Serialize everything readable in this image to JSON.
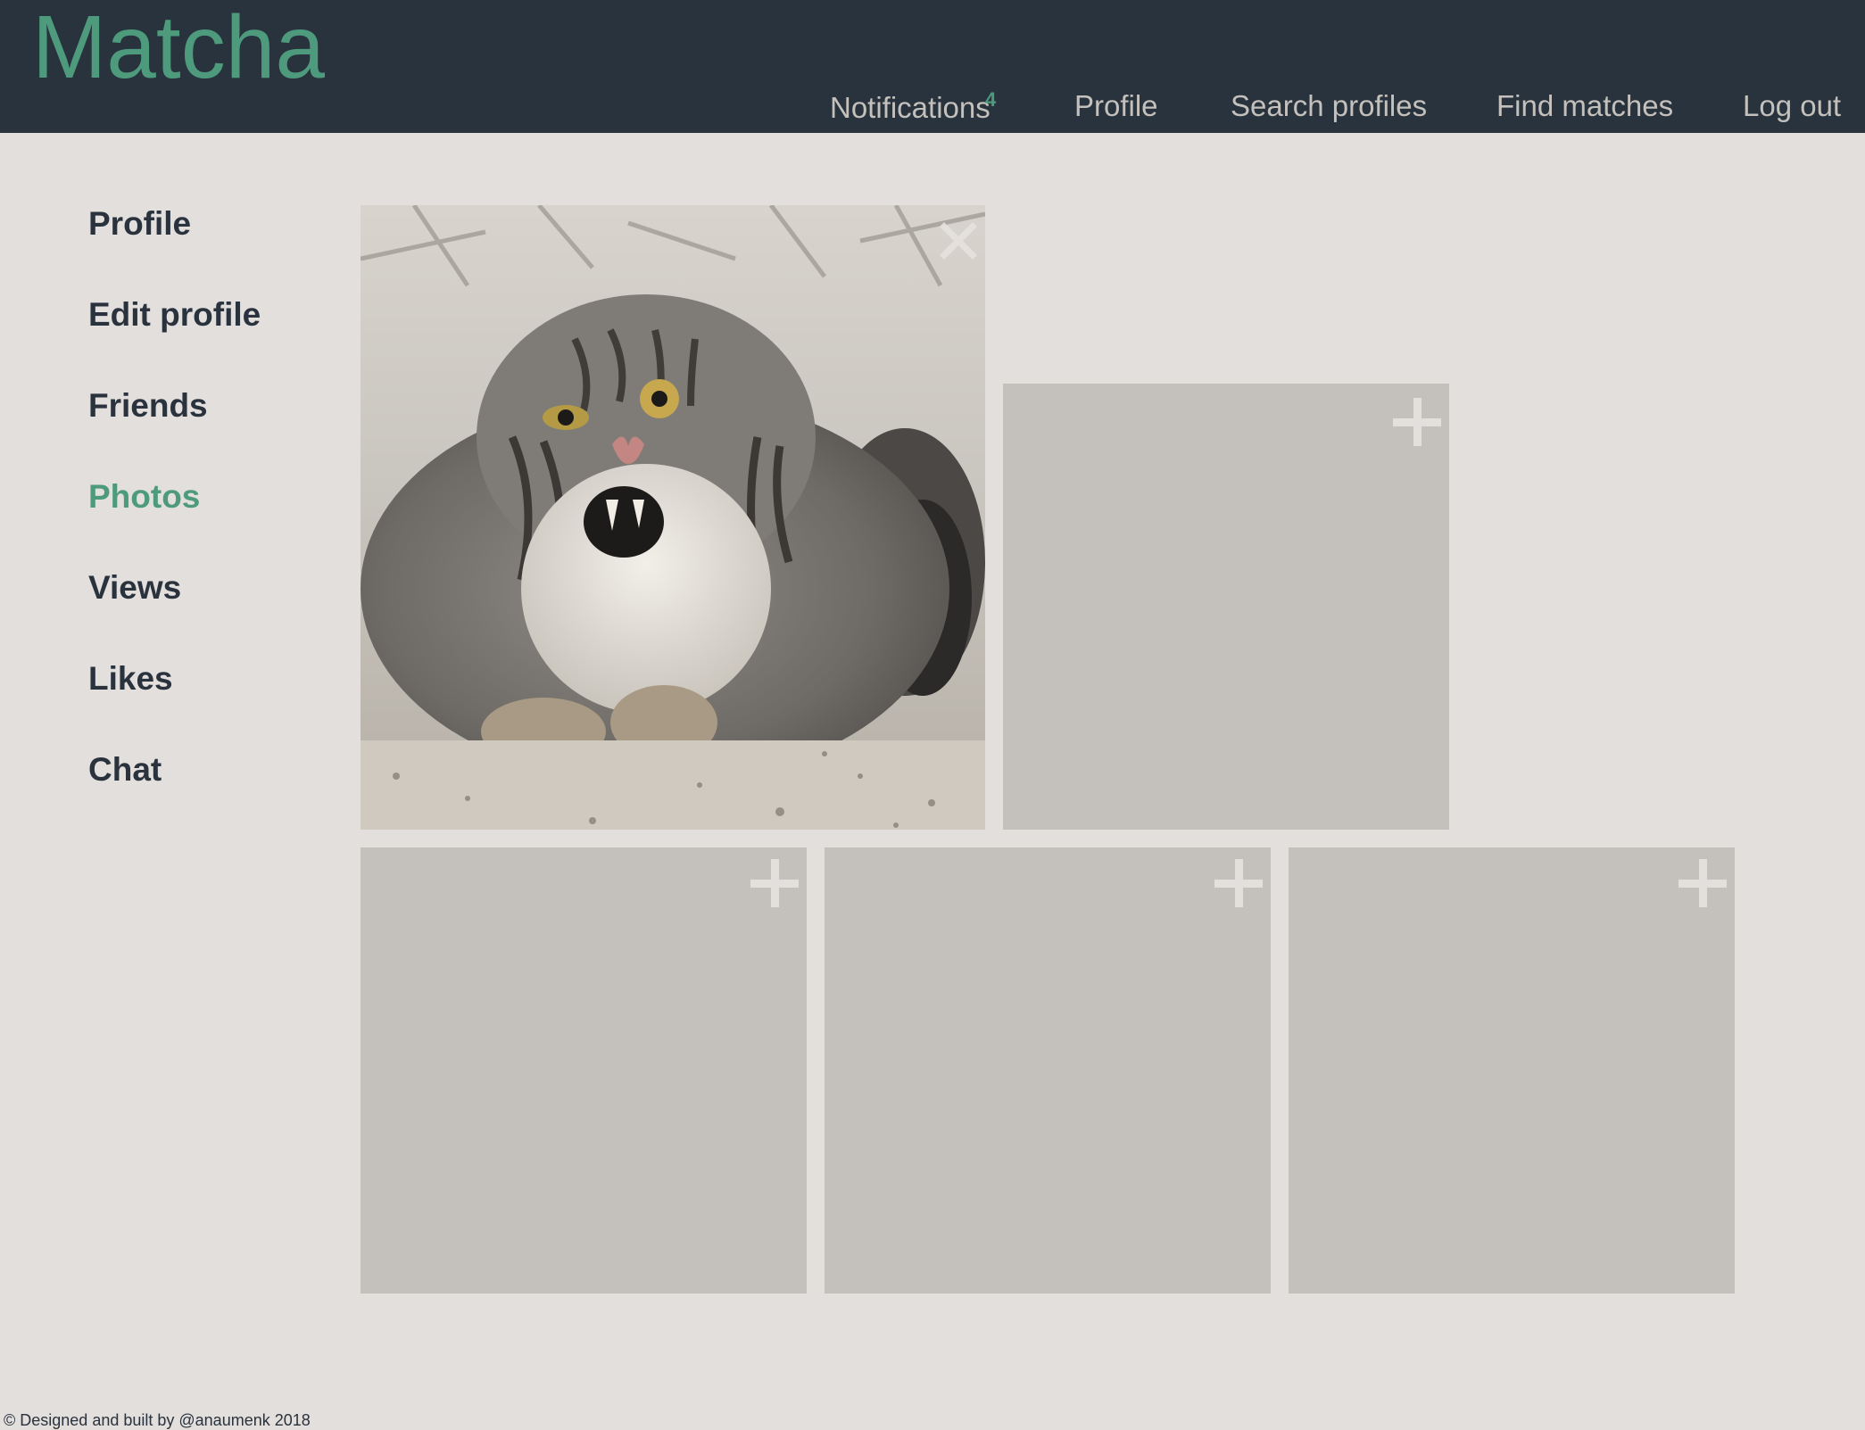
{
  "app": {
    "title": "Matcha"
  },
  "nav": {
    "notifications_label": "Notifications",
    "notifications_count": "4",
    "profile_label": "Profile",
    "search_label": "Search profiles",
    "find_label": "Find matches",
    "logout_label": "Log out"
  },
  "sidebar": {
    "items": [
      {
        "label": "Profile"
      },
      {
        "label": "Edit profile"
      },
      {
        "label": "Friends"
      },
      {
        "label": "Photos"
      },
      {
        "label": "Views"
      },
      {
        "label": "Likes"
      },
      {
        "label": "Chat"
      }
    ],
    "active": "Photos"
  },
  "photos": {
    "icons": {
      "remove": "close-icon",
      "add": "plus-icon"
    }
  },
  "footer": {
    "text": "© Designed and built by @anaumenk 2018"
  },
  "colors": {
    "header_bg": "#28333d",
    "accent": "#4e9a7c",
    "page_bg": "#e2dfdc",
    "tile_bg": "#c4c1bc",
    "nav_text": "#c4c0bc",
    "sidebar_text": "#2a323d"
  }
}
